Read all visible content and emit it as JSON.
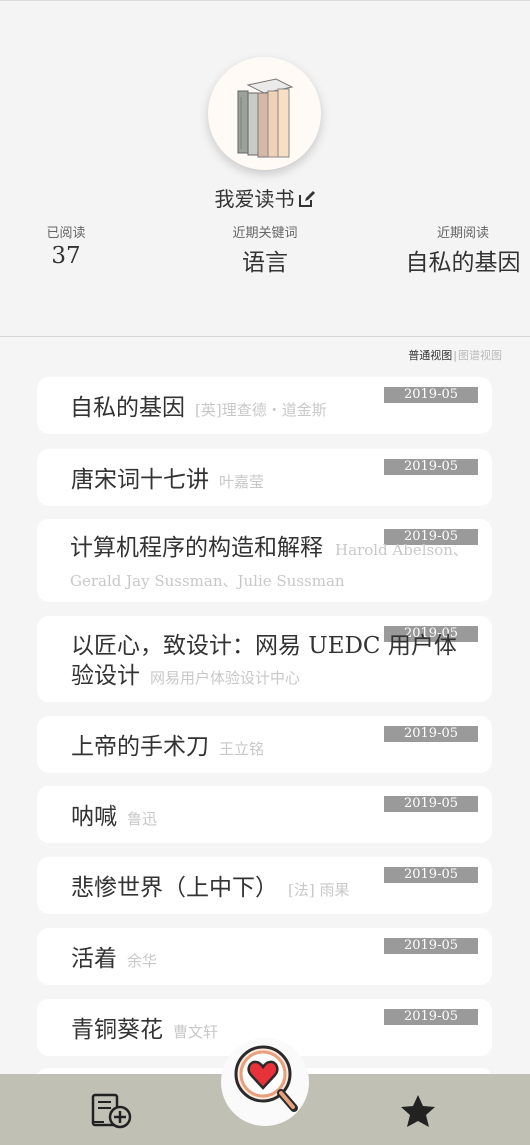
{
  "profile": {
    "username": "我爱读书",
    "stats": {
      "read_label": "已阅读",
      "read_value": "37",
      "keyword_label": "近期关键词",
      "keyword_value": "语言",
      "recent_label": "近期阅读",
      "recent_value": "自私的基因"
    }
  },
  "view_toggle": {
    "normal": "普通视图",
    "separator": "|",
    "graph": "图谱视图"
  },
  "books": [
    {
      "title": "自私的基因",
      "author": "[英]理查德・道金斯",
      "date": "2019-05"
    },
    {
      "title": "唐宋词十七讲",
      "author": "叶嘉莹",
      "date": "2019-05"
    },
    {
      "title": "计算机程序的构造和解释",
      "author": "Harold Abelson、Gerald Jay Sussman、Julie Sussman",
      "date": "2019-05"
    },
    {
      "title": "以匠心，致设计：网易 UEDC 用户体验设计",
      "author": "网易用户体验设计中心",
      "date": "2019-05"
    },
    {
      "title": "上帝的手术刀",
      "author": "王立铭",
      "date": "2019-05"
    },
    {
      "title": "呐喊",
      "author": "鲁迅",
      "date": "2019-05"
    },
    {
      "title": "悲惨世界（上中下）",
      "author": "[法] 雨果",
      "date": "2019-05"
    },
    {
      "title": "活着",
      "author": "余华",
      "date": "2019-05"
    },
    {
      "title": "青铜葵花",
      "author": "曹文轩",
      "date": "2019-05"
    }
  ],
  "bottom_nav": {
    "left_icon": "add-book-icon",
    "center_icon": "heart-search-icon",
    "right_icon": "star-icon",
    "accent": "#e8323a",
    "bar_color": "#c0c1b4"
  }
}
